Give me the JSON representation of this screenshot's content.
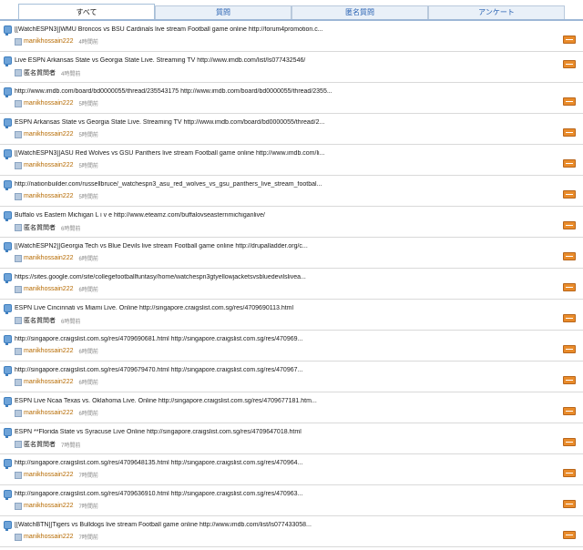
{
  "tabs": [
    {
      "label": "すべて",
      "active": true
    },
    {
      "label": "質問",
      "active": false
    },
    {
      "label": "匿名質問",
      "active": false
    },
    {
      "label": "アンケート",
      "active": false
    }
  ],
  "colors": {
    "tab_text": "#2a63b3",
    "user": "#b66a00",
    "answer_button": "#e98b2a"
  },
  "items": [
    {
      "title": "[[WatchESPN3]]WMU Broncos vs BSU Cardinals live stream Football game online http://forum4promotion.c...",
      "user": "manikhossain222",
      "anon": false,
      "time": "4時間前"
    },
    {
      "title": "Live ESPN Arkansas State vs Georgia State Live. Streaming TV http://www.imdb.com/list/ls077432546/",
      "user": "匿名質問者",
      "anon": true,
      "time": "4時間前"
    },
    {
      "title": "http://www.imdb.com/board/bd0000055/thread/235543175 http://www.imdb.com/board/bd0000055/thread/2355...",
      "user": "manikhossain222",
      "anon": false,
      "time": "5時間前"
    },
    {
      "title": "ESPN Arkansas State vs Georgia State Live. Streaming TV http://www.imdb.com/board/bd0000055/thread/2...",
      "user": "manikhossain222",
      "anon": false,
      "time": "5時間前"
    },
    {
      "title": "[[WatchESPN3]]ASU Red Wolves vs GSU Panthers live stream Football game online http://www.imdb.com/li...",
      "user": "manikhossain222",
      "anon": false,
      "time": "5時間前"
    },
    {
      "title": "http://nationbuilder.com/russellbruce/_watchespn3_asu_red_wolves_vs_gsu_panthers_live_stream_footbal...",
      "user": "manikhossain222",
      "anon": false,
      "time": "5時間前"
    },
    {
      "title": "Buffalo vs Eastern Michigan L i v e http://www.eteamz.com/buffalovseasternmichiganlive/",
      "user": "匿名質問者",
      "anon": true,
      "time": "6時間前"
    },
    {
      "title": "[[WatchESPN2]]Georgia Tech vs Blue Devils live stream Football game online http://drupalladder.org/c...",
      "user": "manikhossain222",
      "anon": false,
      "time": "6時間前"
    },
    {
      "title": "https://sites.google.com/site/collegefootballfuntasy/home/watchespn3gtyellowjacketsvsbluedevilslivea...",
      "user": "manikhossain222",
      "anon": false,
      "time": "6時間前"
    },
    {
      "title": "ESPN Live Cincinnati vs Miami Live. Online http://singapore.craigslist.com.sg/res/4709690113.html",
      "user": "匿名質問者",
      "anon": true,
      "time": "6時間前"
    },
    {
      "title": "http://singapore.craigslist.com.sg/res/4709690681.html http://singapore.craigslist.com.sg/res/470969...",
      "user": "manikhossain222",
      "anon": false,
      "time": "6時間前"
    },
    {
      "title": "http://singapore.craigslist.com.sg/res/4709679470.html http://singapore.craigslist.com.sg/res/470967...",
      "user": "manikhossain222",
      "anon": false,
      "time": "6時間前"
    },
    {
      "title": "ESPN Live Ncaa Texas vs. Oklahoma Live. Online http://singapore.craigslist.com.sg/res/4709677181.htm...",
      "user": "manikhossain222",
      "anon": false,
      "time": "6時間前"
    },
    {
      "title": "ESPN **Florida State vs Syracuse Live Online http://singapore.craigslist.com.sg/res/4709647018.html",
      "user": "匿名質問者",
      "anon": true,
      "time": "7時間前"
    },
    {
      "title": "http://singapore.craigslist.com.sg/res/4709648135.html http://singapore.craigslist.com.sg/res/470964...",
      "user": "manikhossain222",
      "anon": false,
      "time": "7時間前"
    },
    {
      "title": "http://singapore.craigslist.com.sg/res/4709636910.html http://singapore.craigslist.com.sg/res/470963...",
      "user": "manikhossain222",
      "anon": false,
      "time": "7時間前"
    },
    {
      "title": "[[WatchBTN]]Tigers vs Bulldogs live stream Football game online http://www.imdb.com/list/ls077433058...",
      "user": "manikhossain222",
      "anon": false,
      "time": "7時間前"
    }
  ]
}
